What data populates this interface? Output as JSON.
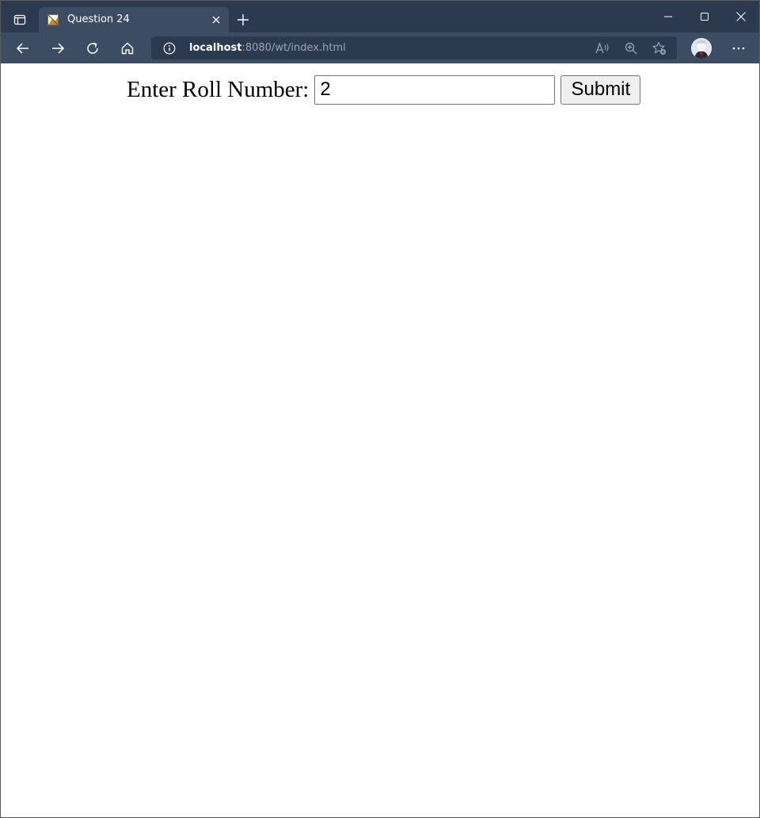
{
  "browser": {
    "tab": {
      "title": "Question 24"
    },
    "address": {
      "host": "localhost",
      "rest": ":8080/wt/index.html"
    },
    "icons": {
      "tab_actions": "tab-actions-icon",
      "close_tab": "close-icon",
      "new_tab": "plus-icon",
      "back": "back-arrow-icon",
      "forward": "forward-arrow-icon",
      "refresh": "refresh-icon",
      "home": "home-icon",
      "info": "info-icon",
      "read_aloud": "read-aloud-icon",
      "zoom": "zoom-in-icon",
      "favorites": "add-favorite-icon",
      "profile": "profile-avatar",
      "more": "more-icon"
    },
    "colors": {
      "titlebar": "#2b3a4e",
      "toolbar": "#3c4d63"
    }
  },
  "page": {
    "label": "Enter Roll Number:",
    "input_value": "2",
    "submit_label": "Submit"
  }
}
